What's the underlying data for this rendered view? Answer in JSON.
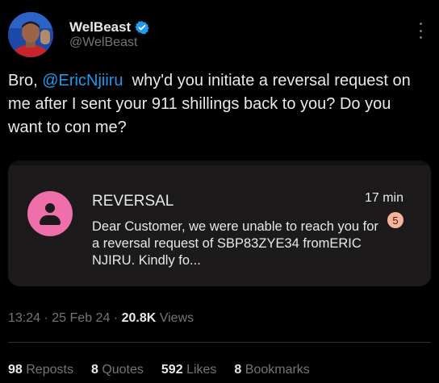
{
  "author": {
    "name": "WelBeast",
    "handle": "@WelBeast",
    "verified_color": "#1d9bf0"
  },
  "tweet": {
    "text_before": "Bro, ",
    "mention": "@EricNjiiru",
    "text_after": "  why'd you initiate a reversal request on me after I sent your 911 shillings back to you? Do you want to con me?"
  },
  "media": {
    "sms": {
      "sender": "REVERSAL",
      "time": "17 min",
      "unread_count": "5",
      "preview": "Dear Customer, we were unable to reach you for a reversal request of SBP83ZYE34 fromERIC NJIRU. Kindly fo..."
    }
  },
  "meta": {
    "time": "13:24",
    "separator": "·",
    "date": "25 Feb 24",
    "views_count": "20.8K",
    "views_label": "Views"
  },
  "stats": {
    "reposts_count": "98",
    "reposts_label": "Reposts",
    "quotes_count": "8",
    "quotes_label": "Quotes",
    "likes_count": "592",
    "likes_label": "Likes",
    "bookmarks_count": "8",
    "bookmarks_label": "Bookmarks"
  },
  "colors": {
    "background": "#000000",
    "text": "#e7e9ea",
    "muted": "#71767b",
    "link": "#1d9bf0",
    "sms_avatar": "#f06ea9",
    "badge": "#f4b59b"
  },
  "icons": [
    "verified-badge-icon",
    "more-options-icon",
    "contact-person-icon"
  ]
}
